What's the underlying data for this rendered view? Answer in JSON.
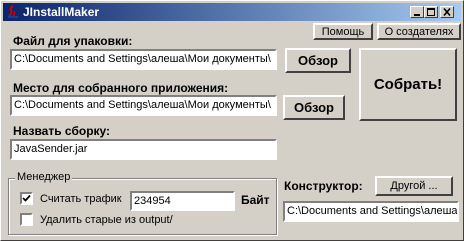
{
  "window": {
    "title": "JInstallMaker",
    "help_label": "Помощь",
    "about_label": "О создателях"
  },
  "package": {
    "label": "Файл для упаковки:",
    "path": "C:\\Documents and Settings\\алеша\\Мои документы\\",
    "browse_label": "Обзор"
  },
  "output": {
    "label": "Место для собранного приложения:",
    "path": "C:\\Documents and Settings\\алеша\\Мои документы\\",
    "browse_label": "Обзор"
  },
  "build": {
    "name_label": "Назвать сборку:",
    "name_value": "JavaSender.jar",
    "build_label": "Собрать!"
  },
  "manager": {
    "group_title": "Менеджер",
    "count_traffic_label": "Считать трафик",
    "count_traffic_checked": true,
    "traffic_value": "234954",
    "traffic_unit": "Байт",
    "delete_old_label": "Удалить старые из output/",
    "delete_old_checked": false
  },
  "constructor": {
    "label": "Конструктор:",
    "other_label": "Другой ...",
    "path": "C:\\Documents and Settings\\алеша"
  }
}
